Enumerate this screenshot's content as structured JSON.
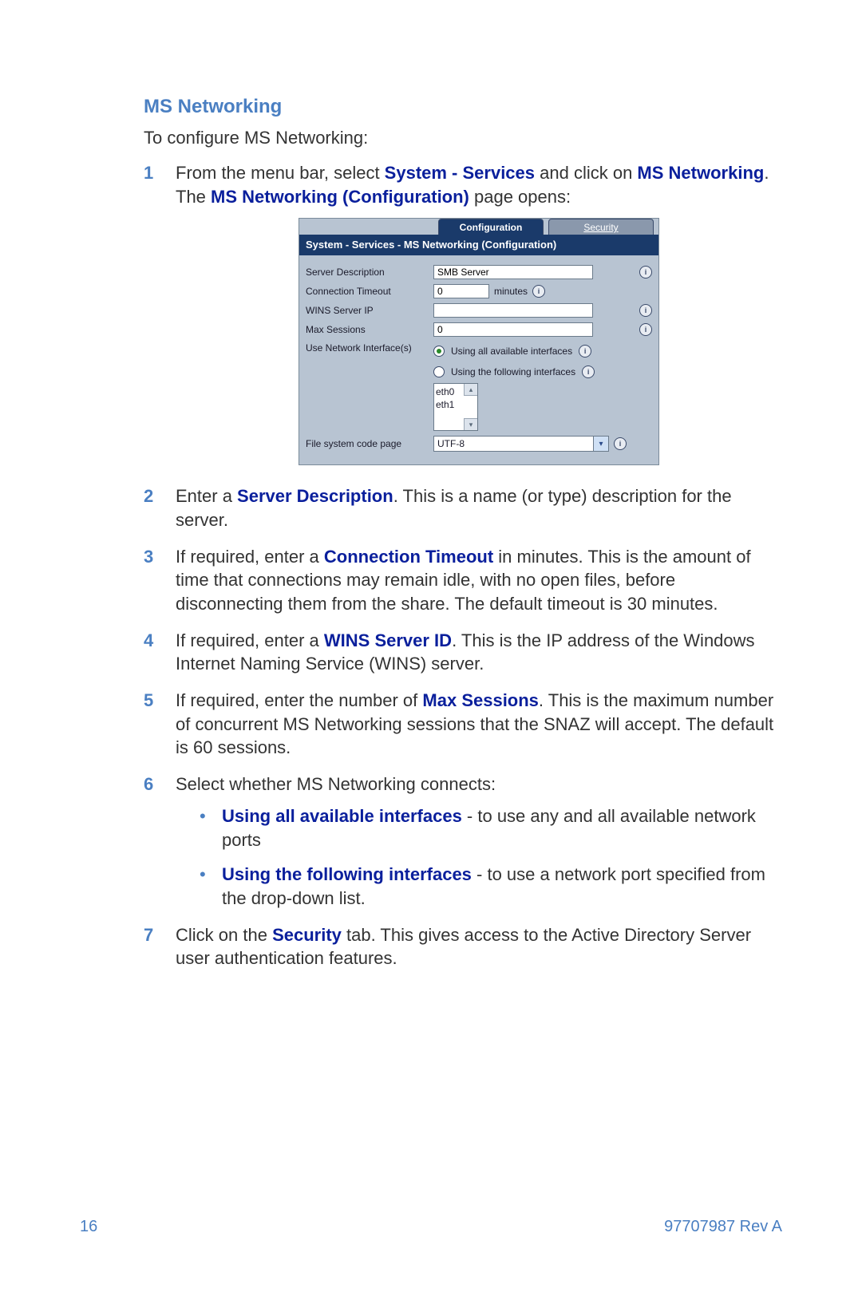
{
  "section_title": "MS Networking",
  "intro": "To configure MS Networking:",
  "step1": {
    "t1": "From the menu bar, select ",
    "b1": "System - Services",
    "t2": " and click on ",
    "b2": "MS Networking",
    "t3": ". The ",
    "b3": "MS Networking (Configuration)",
    "t4": " page opens:"
  },
  "screenshot": {
    "tab_config": "Configuration",
    "tab_security": "Security",
    "panel_title": "System - Services - MS Networking (Configuration)",
    "labels": {
      "server_desc": "Server Description",
      "conn_timeout": "Connection Timeout",
      "wins_ip": "WINS Server IP",
      "max_sessions": "Max Sessions",
      "use_net_if": "Use Network Interface(s)",
      "code_page": "File system code page"
    },
    "values": {
      "server_desc": "SMB Server",
      "conn_timeout": "0",
      "minutes_label": "minutes",
      "wins_ip": "",
      "max_sessions": "0",
      "radio_all": "Using all available interfaces",
      "radio_following": "Using the following interfaces",
      "if0": "eth0",
      "if1": "eth1",
      "code_page": "UTF-8"
    },
    "info_glyph": "i"
  },
  "step2": {
    "t1": "Enter a ",
    "b1": "Server Description",
    "t2": ". This is a name (or type) description for the server."
  },
  "step3": {
    "t1": "If required, enter a ",
    "b1": "Connection Timeout",
    "t2": " in minutes. This is the amount of time that connections may remain idle, with no open files, before disconnecting them from the share. The default timeout is 30 minutes."
  },
  "step4": {
    "t1": "If required, enter a ",
    "b1": "WINS Server ID",
    "t2": ". This is the IP address of the Windows Internet Naming Service (WINS) server."
  },
  "step5": {
    "t1": "If required, enter the number of ",
    "b1": "Max Sessions",
    "t2": ". This is the maximum number of concurrent MS Networking sessions that the SNAZ will accept. The default is 60 sessions."
  },
  "step6": {
    "t1": "Select whether MS Networking connects:",
    "bullet1_b": "Using all available interfaces",
    "bullet1_t": " - to use any and all available network ports",
    "bullet2_b": "Using the following interfaces",
    "bullet2_t": " - to use a network port specified from the drop-down list."
  },
  "step7": {
    "t1": "Click on the ",
    "b1": "Security",
    "t2": " tab. This gives access to the Active Directory Server user authentication features."
  },
  "footer": {
    "page_num": "16",
    "doc_rev": "97707987 Rev A"
  }
}
